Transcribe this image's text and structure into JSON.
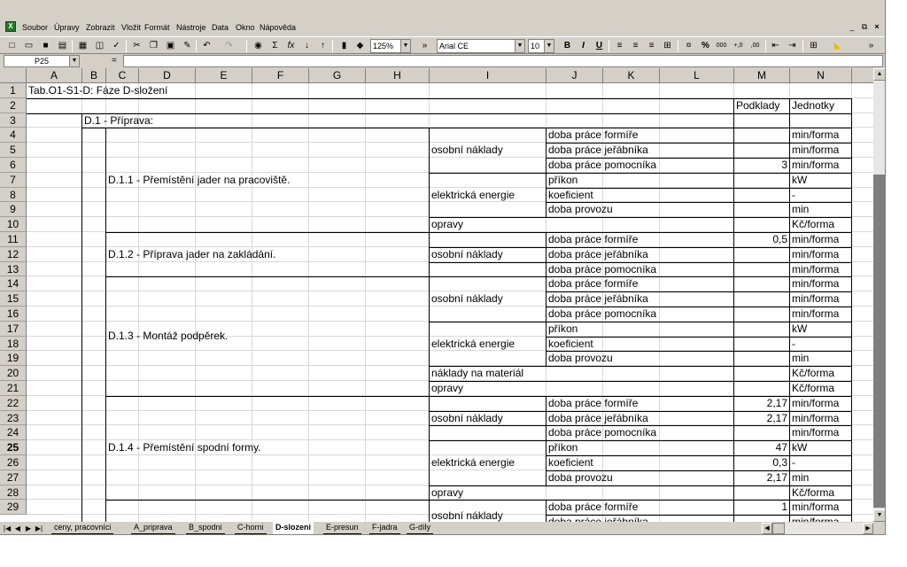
{
  "menu": {
    "items": [
      "Soubor",
      "Úpravy",
      "Zobrazit",
      "Vložit",
      "Formát",
      "Nástroje",
      "Data",
      "Okno",
      "Nápověda"
    ],
    "app_icon": "excel-icon"
  },
  "window_buttons": [
    "_",
    "⧉",
    "×"
  ],
  "toolbar": {
    "zoom": "125%",
    "font": "Arial CE",
    "size": "10",
    "bold": "B",
    "italic": "I",
    "underline": "U",
    "sum": "Σ",
    "fx": "fx",
    "percent": "%",
    "thousands": "000",
    "decimals_inc": "+,0",
    "decimals_dec": ",00"
  },
  "formula_bar": {
    "name_box": "P25",
    "eq": "=",
    "value": ""
  },
  "columns": [
    "A",
    "B",
    "C",
    "D",
    "E",
    "F",
    "G",
    "H",
    "I",
    "J",
    "K",
    "L",
    "M",
    "N"
  ],
  "rows": [
    "1",
    "2",
    "3",
    "4",
    "5",
    "6",
    "7",
    "8",
    "9",
    "10",
    "11",
    "12",
    "13",
    "14",
    "15",
    "16",
    "17",
    "18",
    "19",
    "20",
    "21",
    "22",
    "23",
    "24",
    "25",
    "26",
    "27",
    "28",
    "29"
  ],
  "sheet": {
    "title": "Tab.O1-S1-D: Fáze D-složení",
    "hdr_podklady": "Podklady",
    "hdr_jednotky": "Jednotky",
    "section": "D.1 - Příprava:",
    "groups": [
      "D.1.1 - Přemístění jader na pracoviště.",
      "D.1.2 - Příprava jader na zakládání.",
      "D.1.3 - Montáž podpěrek.",
      "D.1.4 - Přemístění spodní formy."
    ],
    "cat_osobni": "osobní náklady",
    "cat_elektricka": "elektrická energie",
    "cat_opravy": "opravy",
    "cat_material": "náklady na materiál",
    "j": {
      "r4": "doba práce formíře",
      "r5": "doba práce jeřábníka",
      "r6": "doba práce pomocníka",
      "r7": "příkon",
      "r8": "koeficient",
      "r9": "doba provozu",
      "r11": "doba práce formíře",
      "r12": "doba práce jeřábníka",
      "r13": "doba práce pomocníka",
      "r14": "doba práce formíře",
      "r15": "doba práce jeřábníka",
      "r16": "doba práce pomocníka",
      "r17": "příkon",
      "r18": "koeficient",
      "r19": "doba provozu",
      "r22": "doba práce formíře",
      "r23": "doba práce jeřábníka",
      "r24": "doba práce pomocníka",
      "r25": "příkon",
      "r26": "koeficient",
      "r27": "doba provozu",
      "r29": "doba práce formíře",
      "r30": "doba práce jeřábníka"
    },
    "m": {
      "r6": "3",
      "r11": "0,5",
      "r22": "2,17",
      "r23": "2,17",
      "r25": "47",
      "r26": "0,3",
      "r27": "2,17",
      "r29": "1"
    },
    "n": {
      "r4": "min/forma",
      "r5": "min/forma",
      "r6": "min/forma",
      "r7": "kW",
      "r8": "-",
      "r9": "min",
      "r10": "Kč/forma",
      "r11": "min/forma",
      "r12": "min/forma",
      "r13": "min/forma",
      "r14": "min/forma",
      "r15": "min/forma",
      "r16": "min/forma",
      "r17": "kW",
      "r18": "-",
      "r19": "min",
      "r20": "Kč/forma",
      "r21": "Kč/forma",
      "r22": "min/forma",
      "r23": "min/forma",
      "r24": "min/forma",
      "r25": "kW",
      "r26": "-",
      "r27": "min",
      "r28": "Kč/forma",
      "r29": "min/forma",
      "r30": "min/forma"
    }
  },
  "sheet_tabs": [
    "ceny, pracovníci",
    "A_priprava",
    "B_spodni",
    "C-horni",
    "D-slozeni",
    "E-presun",
    "F-jadra",
    "G-díly"
  ],
  "active_tab": "D-slozeni",
  "colors": {
    "chrome": "#d4d0c8",
    "scroll_thumb": "#7e7e7e"
  }
}
